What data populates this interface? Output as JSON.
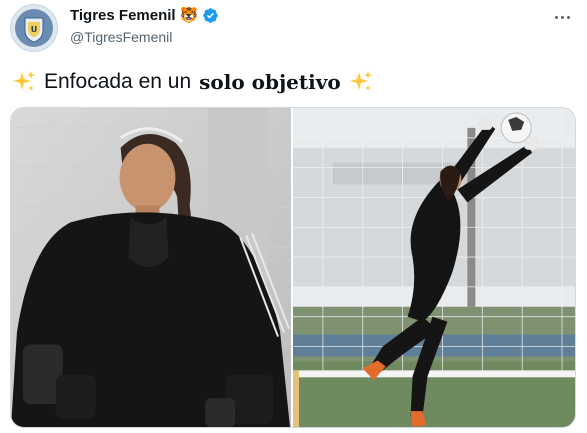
{
  "account": {
    "display_name": "Tigres Femenil",
    "name_emoji": "🐯",
    "handle": "@TigresFemenil",
    "verified_icon": "verified-badge-icon",
    "avatar_icon": "club-crest-icon"
  },
  "tweet": {
    "text_prefix": "Enfocada en un",
    "text_bold": "solo objetivo",
    "decoration_icon": "sparkles-icon"
  },
  "media": {
    "count": 2,
    "left_photo_icon": "goalkeeper-portrait-photo",
    "right_photo_icon": "goalkeeper-save-photo"
  },
  "colors": {
    "verified_blue": "#1d9bf0",
    "secondary_text": "#536471",
    "sparkle_gold": "#ffc83d"
  }
}
